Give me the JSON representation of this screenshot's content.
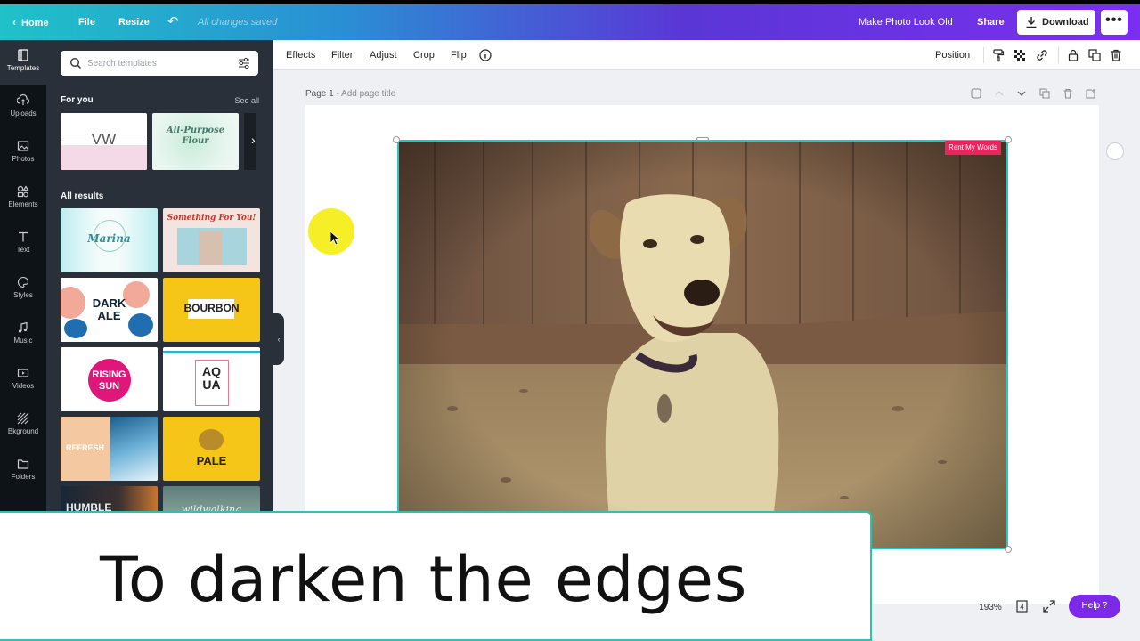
{
  "topbar": {
    "home": "Home",
    "file": "File",
    "resize": "Resize",
    "saved_status": "All changes saved",
    "design_title": "Make Photo Look Old",
    "share": "Share",
    "download": "Download",
    "more": "•••"
  },
  "rail": [
    {
      "label": "Templates",
      "icon": "templates-icon"
    },
    {
      "label": "Uploads",
      "icon": "upload-icon"
    },
    {
      "label": "Photos",
      "icon": "photo-icon"
    },
    {
      "label": "Elements",
      "icon": "elements-icon"
    },
    {
      "label": "Text",
      "icon": "text-icon"
    },
    {
      "label": "Styles",
      "icon": "palette-icon"
    },
    {
      "label": "Music",
      "icon": "music-icon"
    },
    {
      "label": "Videos",
      "icon": "video-icon"
    },
    {
      "label": "Bkground",
      "icon": "background-icon"
    },
    {
      "label": "Folders",
      "icon": "folder-icon"
    }
  ],
  "panel": {
    "search_placeholder": "Search templates",
    "for_you": "For you",
    "see_all": "See all",
    "all_results": "All results",
    "for_you_thumbs": [
      "VW",
      "All-Purpose Flour"
    ],
    "results": [
      "Marina",
      "Something For You!",
      "DARK ALE",
      "BOURBON",
      "RISING SUN",
      "AQ UA",
      "REFRESH",
      "PALE",
      "HUMBLE",
      "wildwalking"
    ]
  },
  "toolbar": {
    "effects": "Effects",
    "filter": "Filter",
    "adjust": "Adjust",
    "crop": "Crop",
    "flip": "Flip",
    "position": "Position"
  },
  "page": {
    "label": "Page 1",
    "title_hint": "- Add page title"
  },
  "photo": {
    "credit_tag": "Rent My Words"
  },
  "bottom": {
    "zoom": "193%",
    "help": "Help ?"
  },
  "caption": "To darken the edges",
  "colors": {
    "accent_teal": "#28c4c7",
    "brand_purple": "#7d2ae8",
    "tag_red": "#e8265d",
    "cursor_highlight": "#f5ee1c"
  }
}
